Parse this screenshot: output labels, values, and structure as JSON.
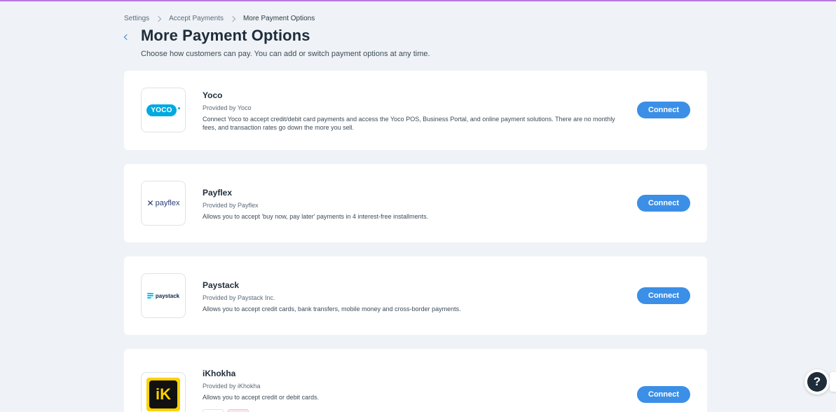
{
  "breadcrumb": {
    "items": [
      "Settings",
      "Accept Payments",
      "More Payment Options"
    ]
  },
  "header": {
    "title": "More Payment Options",
    "subtitle": "Choose how customers can pay. You can add or switch payment options at any time."
  },
  "providers": [
    {
      "name": "Yoco",
      "provider": "Provided by Yoco",
      "description": "Connect Yoco to accept credit/debit card payments and access the Yoco POS, Business Portal, and online payment solutions. There are no monthly fees, and transaction rates go down the more you sell.",
      "button": "Connect",
      "logo_text": "YOCO"
    },
    {
      "name": "Payflex",
      "provider": "Provided by Payflex",
      "description": "Allows you to accept 'buy now, pay later' payments in 4 interest-free installments.",
      "button": "Connect",
      "logo_text": "payflex"
    },
    {
      "name": "Paystack",
      "provider": "Provided by Paystack Inc.",
      "description": "Allows you to accept credit cards, bank transfers, mobile money and cross-border payments.",
      "button": "Connect",
      "logo_text": "paystack"
    },
    {
      "name": "iKhokha",
      "provider": "Provided by iKhokha",
      "description": "Allows you to accept credit or debit cards.",
      "button": "Connect",
      "logo_text": "iK"
    }
  ],
  "help": {
    "label": "?"
  },
  "colors": {
    "accent": "#3b8fe6",
    "background": "#eff3f7",
    "top_bar": "#b678e0",
    "yoco": "#00a9e0",
    "ikhokha": "#fcd200"
  }
}
